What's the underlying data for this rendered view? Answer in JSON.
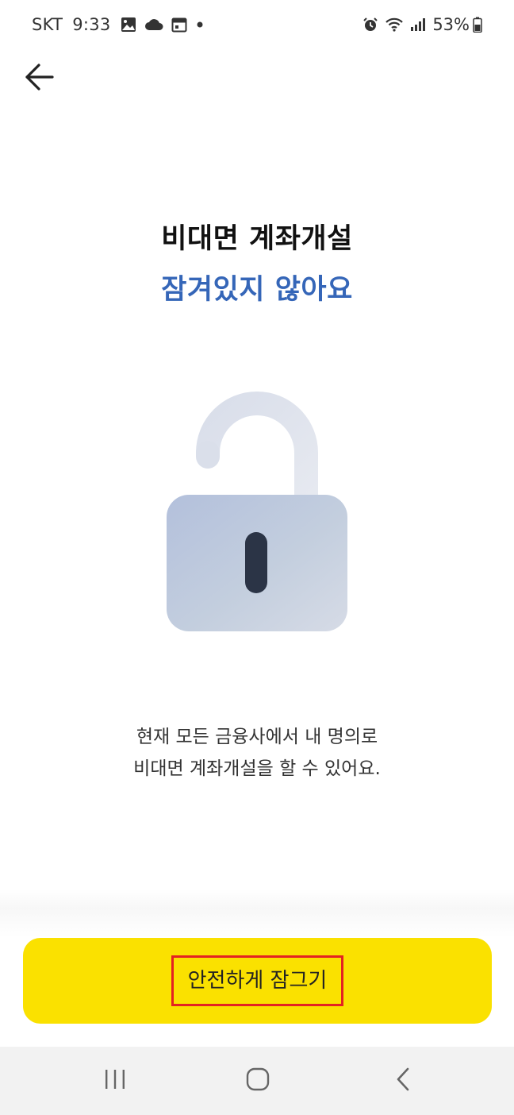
{
  "status_bar": {
    "carrier": "SKT",
    "time": "9:33",
    "battery": "53%",
    "icons_left": [
      "image-icon",
      "cloud-icon",
      "calendar-icon",
      "dot-icon"
    ],
    "icons_right": [
      "alarm-icon",
      "wifi-icon",
      "signal-icon",
      "battery-icon"
    ]
  },
  "header": {
    "back_icon": "back-arrow-icon"
  },
  "main": {
    "title_line1": "비대면 계좌개설",
    "title_line2": "잠겨있지 않아요",
    "illustration_icon": "unlocked-padlock-icon",
    "description_line1": "현재 모든 금융사에서 내 명의로",
    "description_line2": "비대면 계좌개설을 할 수 있어요."
  },
  "footer": {
    "primary_button_label": "안전하게 잠그기"
  },
  "nav_bar": {
    "icons": [
      "recent-apps-icon",
      "home-icon",
      "nav-back-icon"
    ]
  },
  "colors": {
    "accent_blue": "#3566b8",
    "button_yellow": "#fae100",
    "highlight_red": "#e32222"
  }
}
